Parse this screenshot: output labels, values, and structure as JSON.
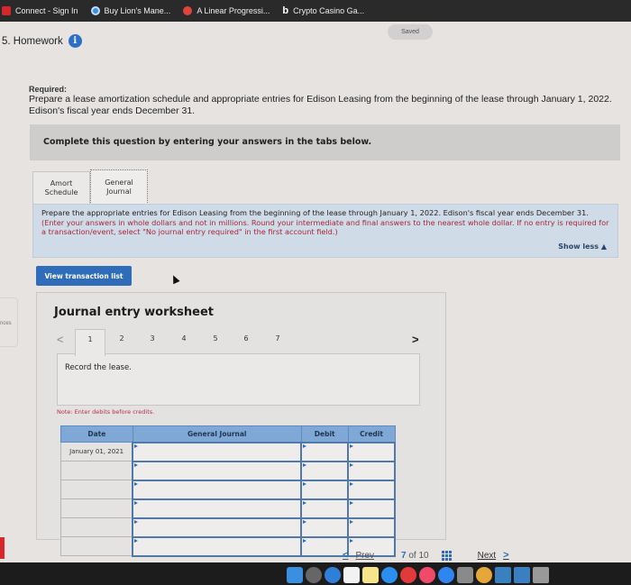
{
  "browser": {
    "bookmarks": [
      {
        "label": "Connect - Sign In",
        "icon": "connect-icon"
      },
      {
        "label": "Buy Lion's Mane...",
        "icon": "lions-mane-icon"
      },
      {
        "label": "A Linear Progressi...",
        "icon": "linear-progression-icon"
      },
      {
        "label": "Crypto Casino Ga...",
        "icon": "crypto-casino-icon"
      }
    ]
  },
  "header": {
    "title": "5. Homework",
    "info_glyph": "i",
    "saved_label": "Saved"
  },
  "sidebar_fragment": "nces",
  "question": {
    "required_label": "Required:",
    "required_text": "Prepare a lease amortization schedule and appropriate entries for Edison Leasing from the beginning of the lease through January 1, 2022. Edison's fiscal year ends December 31.",
    "complete_prompt": "Complete this question by entering your answers in the tabs below."
  },
  "tabs": [
    {
      "line1": "Amort",
      "line2": "Schedule",
      "active": false
    },
    {
      "line1": "General",
      "line2": "Journal",
      "active": true
    }
  ],
  "instructions": {
    "main": "Prepare the appropriate entries for Edison Leasing from the beginning of the lease through January 1, 2022. Edison's fiscal year ends December 31.",
    "note": "(Enter your answers in whole dollars and not in millions. Round your intermediate and final answers to the nearest whole dollar. If no entry is required for a transaction/event, select \"No journal entry required\" in the first account field.)",
    "show_less": "Show less ▲"
  },
  "view_transaction_list": "View transaction list",
  "worksheet": {
    "title": "Journal entry worksheet",
    "prev_glyph": "<",
    "next_glyph": ">",
    "steps": [
      "1",
      "2",
      "3",
      "4",
      "5",
      "6",
      "7"
    ],
    "active_step": "1",
    "record_text": "Record the lease.",
    "note": "Note: Enter debits before credits.",
    "columns": [
      "Date",
      "General Journal",
      "Debit",
      "Credit"
    ],
    "rows": [
      {
        "date": "January 01, 2021",
        "account": "",
        "debit": "",
        "credit": ""
      },
      {
        "date": "",
        "account": "",
        "debit": "",
        "credit": ""
      },
      {
        "date": "",
        "account": "",
        "debit": "",
        "credit": ""
      },
      {
        "date": "",
        "account": "",
        "debit": "",
        "credit": ""
      },
      {
        "date": "",
        "account": "",
        "debit": "",
        "credit": ""
      },
      {
        "date": "",
        "account": "",
        "debit": "",
        "credit": ""
      }
    ]
  },
  "pagination": {
    "prev_label": "Prev",
    "current": "7",
    "of_label": "of 10",
    "next_label": "Next"
  },
  "colors": {
    "accent_blue": "#2f6cba",
    "table_header": "#7fa8d6",
    "instruction_bg": "#cfdbe6",
    "note_red": "#a6283c"
  }
}
